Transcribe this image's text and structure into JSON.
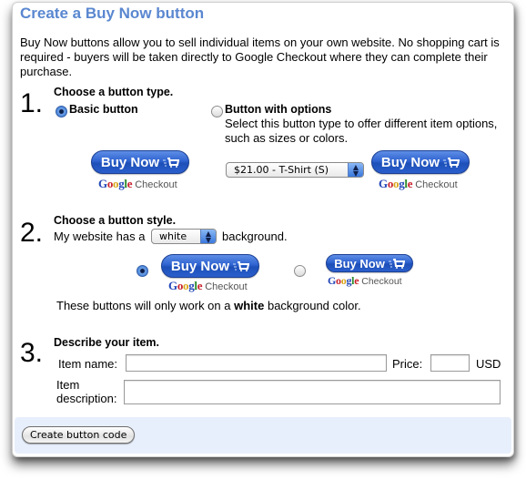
{
  "title": "Create a Buy Now button",
  "intro": "Buy Now buttons allow you to sell individual items on your own website. No shopping cart is required - buyers will be taken directly to Google Checkout where they can complete their purchase.",
  "step1": {
    "number": "1.",
    "heading": "Choose a button type.",
    "options": [
      {
        "label": "Basic button",
        "selected": true
      },
      {
        "label": "Button with options",
        "selected": false,
        "description": "Select this button type to offer different item options, such as sizes or colors."
      }
    ],
    "options_select": {
      "value": "$21.00 - T-Shirt (S)"
    }
  },
  "step2": {
    "number": "2.",
    "heading": "Choose a button style.",
    "prefix": "My website has a",
    "background_select": {
      "value": "white"
    },
    "suffix": "background.",
    "styles": [
      {
        "size": "large",
        "selected": true
      },
      {
        "size": "small",
        "selected": false
      }
    ],
    "note_prefix": "These buttons will only work on a",
    "note_color": "white",
    "note_suffix": "background color."
  },
  "step3": {
    "number": "3.",
    "heading": "Describe your item.",
    "item_name_label": "Item name:",
    "item_name_value": "",
    "price_label": "Price:",
    "price_value": "",
    "currency": "USD",
    "description_label_line1": "Item",
    "description_label_line2": "description:",
    "description_value": ""
  },
  "buy_button": {
    "label": "Buy Now",
    "google_letters": [
      "G",
      "o",
      "o",
      "g",
      "l",
      "e"
    ],
    "checkout": "Checkout"
  },
  "footer": {
    "create_button": "Create button code"
  },
  "colors": {
    "title": "#5a87d0",
    "buy_button": "#2f63d0",
    "footer_bg": "#e8effc"
  }
}
